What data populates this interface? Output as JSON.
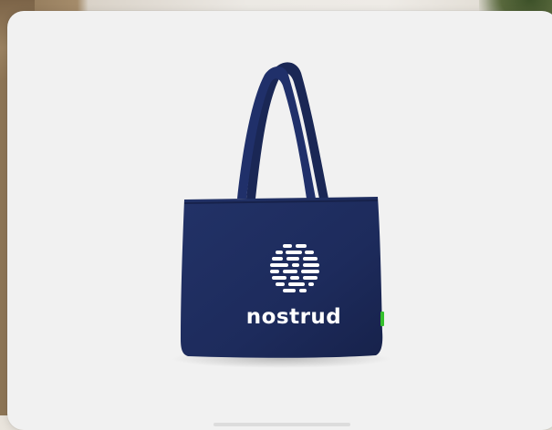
{
  "product": {
    "brand_text": "nostrud",
    "bag_color": "#1d2b5c",
    "tag_color": "#35c02e",
    "card_background": "#f1f1f1"
  }
}
